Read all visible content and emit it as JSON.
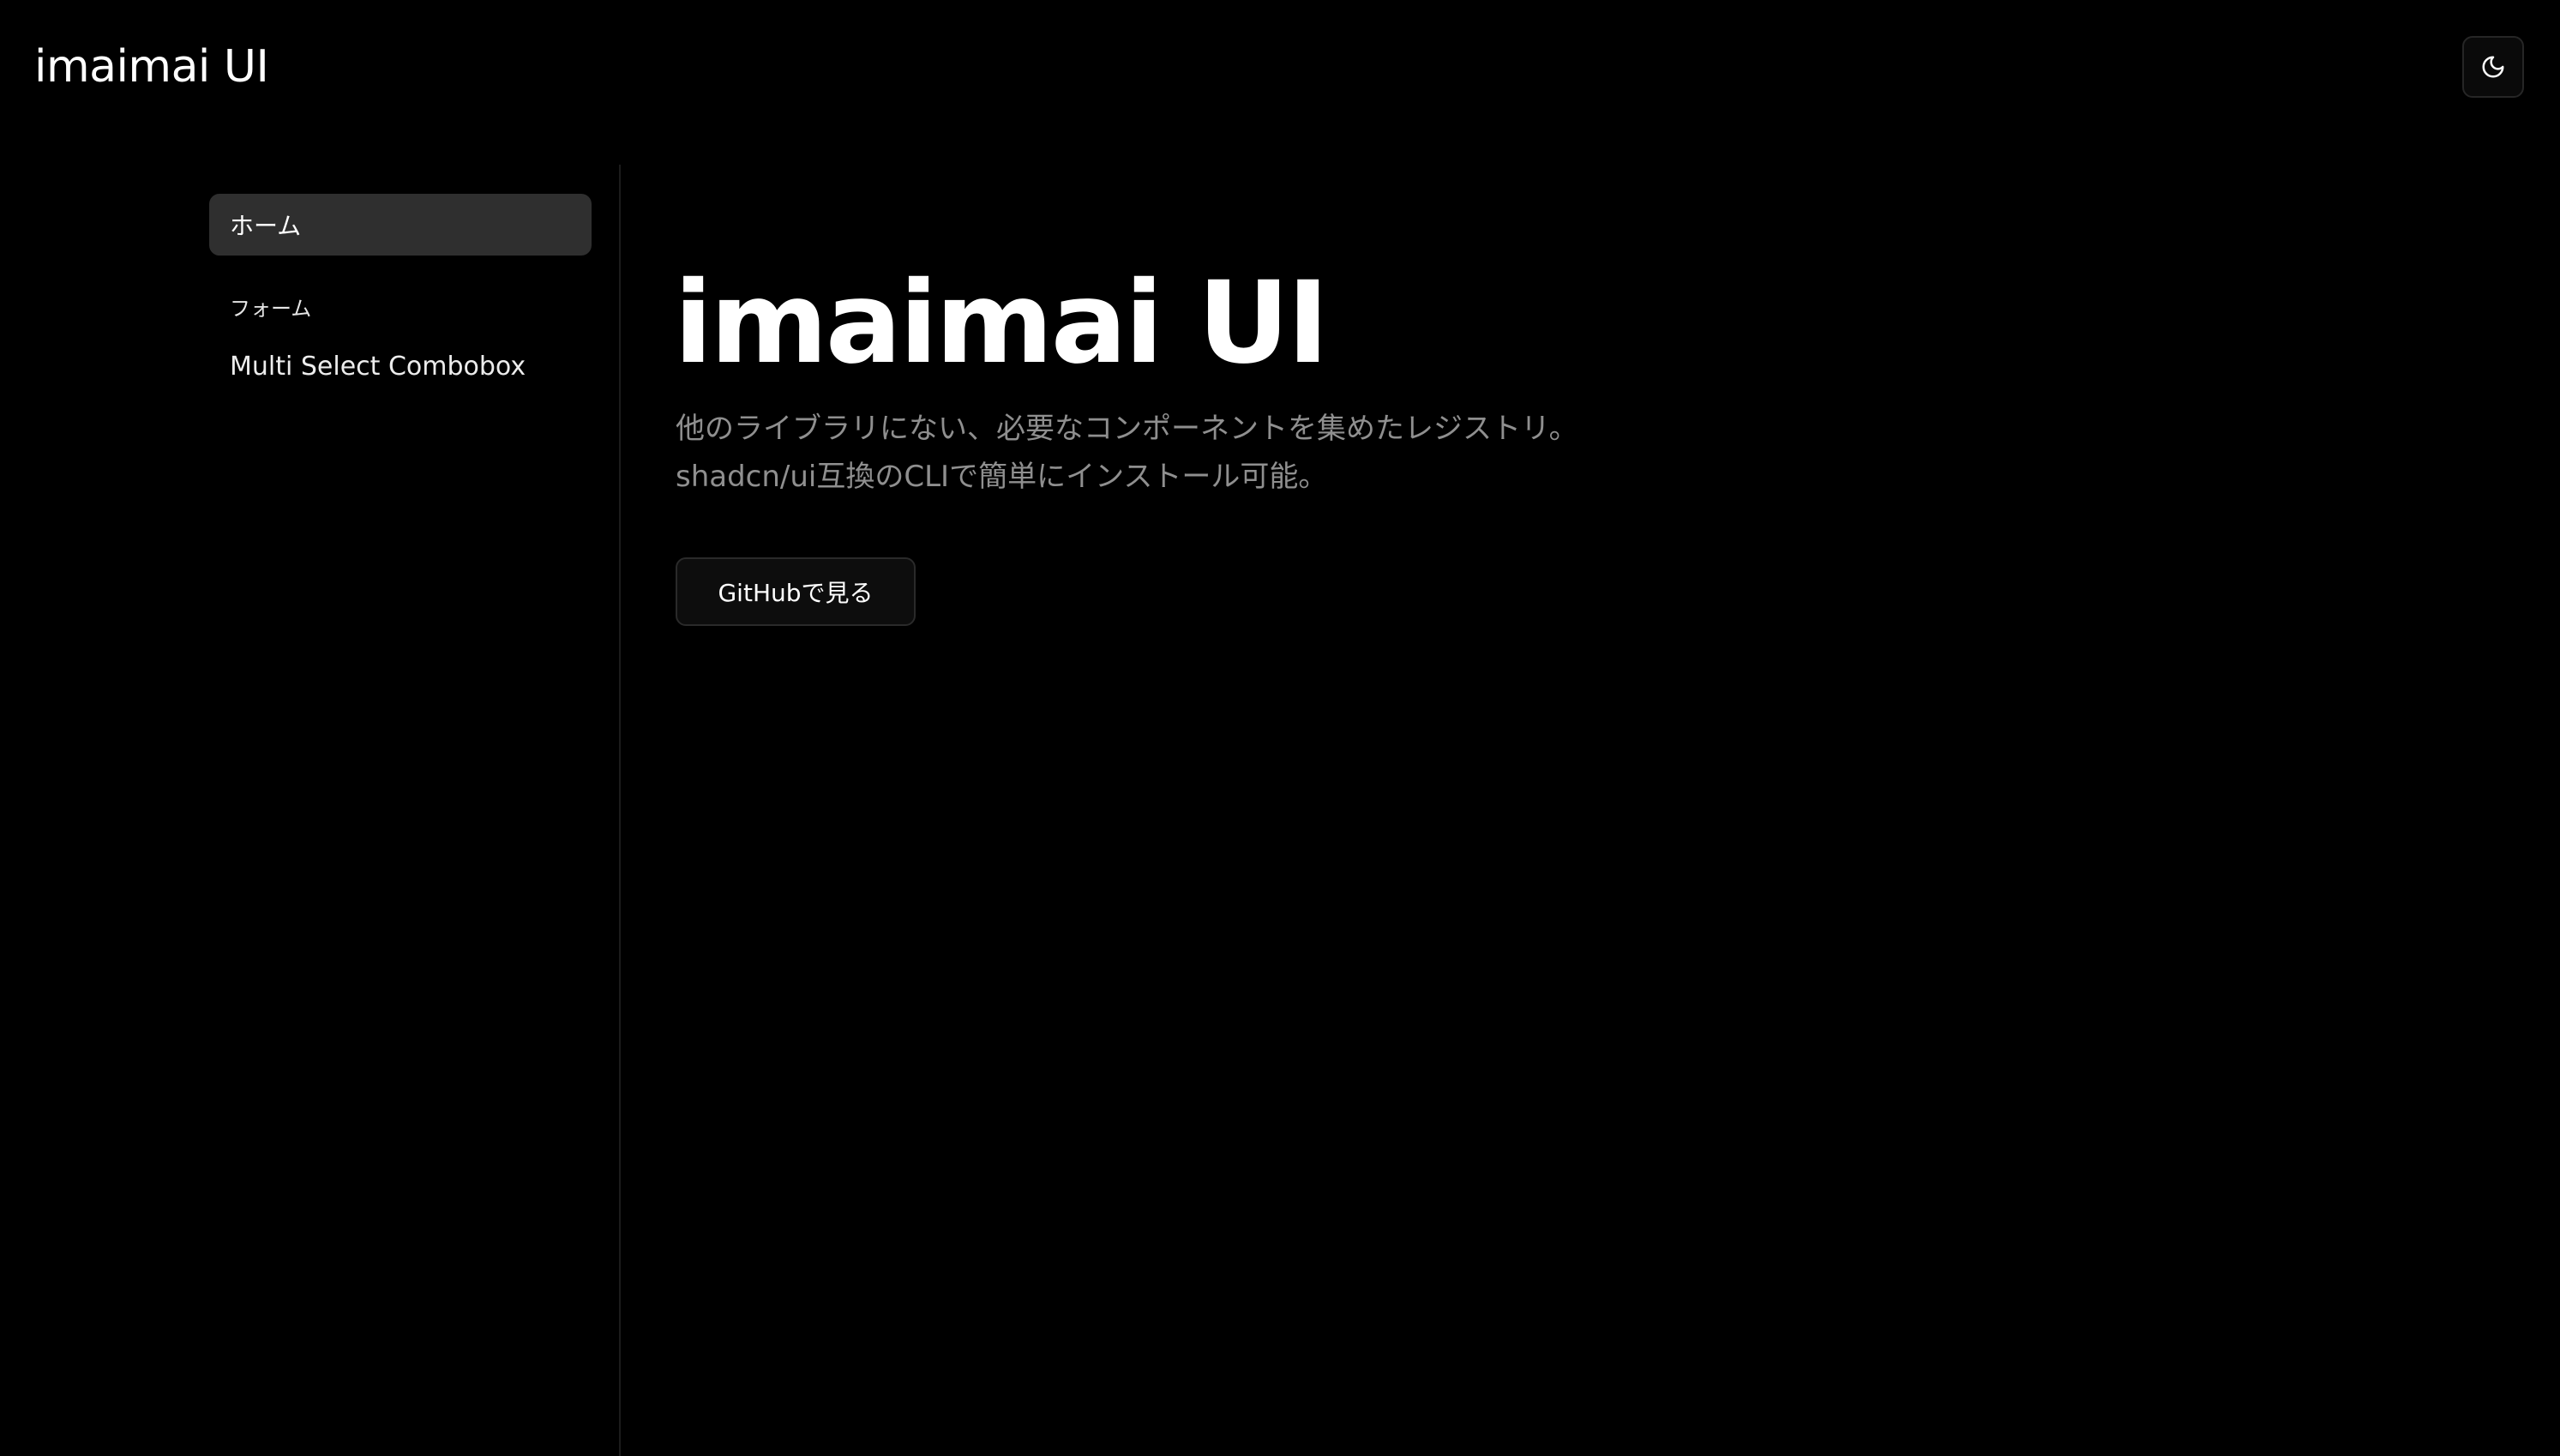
{
  "header": {
    "site_title": "imaimai UI",
    "theme_toggle_icon": "moon-icon"
  },
  "sidebar": {
    "items": [
      {
        "label": "ホーム",
        "active": true
      }
    ],
    "groups": [
      {
        "label": "フォーム",
        "items": [
          {
            "label": "Multi Select Combobox",
            "active": false
          }
        ]
      }
    ]
  },
  "main": {
    "title": "imaimai UI",
    "description_lines": [
      "他のライブラリにない、必要なコンポーネントを集めたレジストリ。",
      "shadcn/ui互換のCLIで簡単にインストール可能。"
    ],
    "github_button_label": "GitHubで見る"
  },
  "colors": {
    "background": "#000000",
    "text_primary": "#ffffff",
    "text_muted": "#8f8f8f",
    "active_item_bg": "#2f2f2f",
    "border": "#262626"
  }
}
